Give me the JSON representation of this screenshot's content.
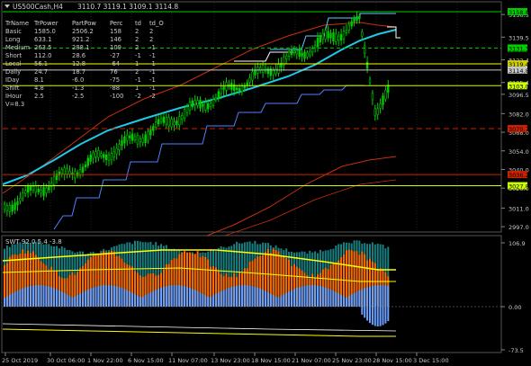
{
  "header": {
    "symbol_timeframe": "US500Cash,H4",
    "ohlc": "3110.7 3119.1 3109.1 3114.8"
  },
  "stats_table": {
    "headers": [
      "TrName",
      "TrPower",
      "PartPow",
      "Perc",
      "td",
      "td_O"
    ],
    "rows": [
      [
        "Basic",
        "1585.0",
        "2506.2",
        "158",
        "2",
        "2"
      ],
      [
        "Long",
        "633.1",
        "921.2",
        "146",
        "2",
        "2"
      ],
      [
        "Medium",
        "263.5",
        "288.1",
        "109",
        "2",
        "-1"
      ],
      [
        "Short",
        "112.0",
        "28.6",
        "-27",
        "-1",
        "-1"
      ],
      [
        "Local",
        "56.1",
        "12.8",
        "-64",
        "1",
        "-1"
      ],
      [
        "Daily",
        "24.7",
        "18.7",
        "76",
        "2",
        "-1"
      ],
      [
        "IDay",
        "8.1",
        "-6.0",
        "-75",
        "-1",
        "-1"
      ],
      [
        "Shift",
        "4.8",
        "-1.3",
        "-88",
        "1",
        "-1"
      ],
      [
        "IHour",
        "2.5",
        "-2.5",
        "-100",
        "-2",
        "-2"
      ]
    ],
    "footer": "V=8.3"
  },
  "price_axis": {
    "labels": [
      "3156.5",
      "3139.5",
      "3122.4",
      "3105.4",
      "3096.5",
      "3082.0",
      "3068.0",
      "3054.0",
      "3040.0",
      "3026.0",
      "3011.0",
      "2997.0"
    ],
    "markers": [
      {
        "value": "3158.6",
        "color": "#00cc00",
        "text_color": "#000000"
      },
      {
        "value": "3131.3",
        "color": "#00cc00",
        "text_color": "#000000"
      },
      {
        "value": "3119.4",
        "color": "#cccc00",
        "text_color": "#000000"
      },
      {
        "value": "3114.8",
        "color": "#c8c8c8",
        "text_color": "#000000"
      },
      {
        "value": "3103.0",
        "color": "#ccff00",
        "text_color": "#000000"
      },
      {
        "value": "3070.7",
        "color": "#cc2200",
        "text_color": "#000000"
      },
      {
        "value": "3036.2",
        "color": "#cc2200",
        "text_color": "#000000"
      },
      {
        "value": "3027.8",
        "color": "#ccff00",
        "text_color": "#000000"
      }
    ]
  },
  "indicator": {
    "label": "SWT 92.0 5.4 -3.8",
    "axis_labels": [
      "106.9",
      "0.00",
      "-73.5"
    ]
  },
  "time_axis": {
    "labels": [
      "25 Oct 2019",
      "30 Oct 06:00",
      "1 Nov 22:00",
      "6 Nov 15:00",
      "11 Nov 07:00",
      "13 Nov 23:00",
      "18 Nov 15:00",
      "21 Nov 07:00",
      "25 Nov 23:00",
      "28 Nov 15:00",
      "3 Dec 15:00"
    ]
  },
  "colors": {
    "background": "#000000",
    "grid": "#202020",
    "bull_candle": "#00cc00",
    "bear_candle": "#00cc00",
    "ma_cyan": "#20c8e8",
    "envelope_red": "#c83010",
    "steps_blue": "#5080ff",
    "hist_orange": "#ff6a00",
    "hist_blue": "#6aa0ff",
    "hist_teal": "#188080",
    "level_yellow": "#ffff00"
  }
}
